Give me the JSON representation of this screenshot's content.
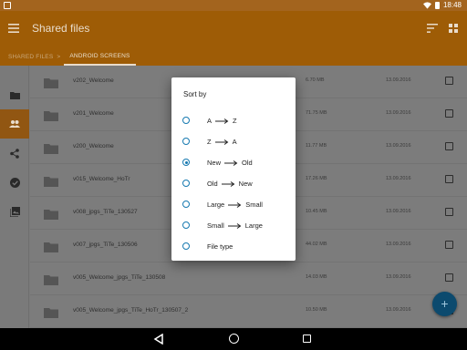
{
  "status_bar": {
    "time": "18:48"
  },
  "app_bar": {
    "title": "Shared files",
    "breadcrumbs": [
      "SHARED FILES",
      "ANDROID SCREENS"
    ],
    "breadcrumb_separator": ">"
  },
  "sidebar": {
    "items": [
      {
        "icon": "folder-icon",
        "active": false
      },
      {
        "icon": "people-icon",
        "active": true
      },
      {
        "icon": "share-icon",
        "active": false
      },
      {
        "icon": "checkmark-icon",
        "active": false
      },
      {
        "icon": "gallery-icon",
        "active": false
      }
    ]
  },
  "files": [
    {
      "name": "v202_Welcome",
      "size": "6.70 MB",
      "date": "13.09.2016"
    },
    {
      "name": "v201_Welcome",
      "size": "71.75 MB",
      "date": "13.09.2016"
    },
    {
      "name": "v200_Welcome",
      "size": "11.77 MB",
      "date": "13.09.2016"
    },
    {
      "name": "v015_Welcome_HoTr",
      "size": "17.26 MB",
      "date": "13.09.2016"
    },
    {
      "name": "v008_jpgs_TiTe_130527",
      "size": "10.45 MB",
      "date": "13.09.2016"
    },
    {
      "name": "v007_jpgs_TiTe_130506",
      "size": "44.02 MB",
      "date": "13.09.2016"
    },
    {
      "name": "v005_Welcome_jpgs_TiTe_130508",
      "size": "14.03 MB",
      "date": "13.09.2016"
    },
    {
      "name": "v005_Welcome_jpgs_TiTe_HoTr_130507_2",
      "size": "10.50 MB",
      "date": "13.09.2016"
    }
  ],
  "dialog": {
    "title": "Sort by",
    "options": [
      {
        "from": "A",
        "to": "Z",
        "selected": false
      },
      {
        "from": "Z",
        "to": "A",
        "selected": false
      },
      {
        "from": "New",
        "to": "Old",
        "selected": true
      },
      {
        "from": "Old",
        "to": "New",
        "selected": false
      },
      {
        "from": "Large",
        "to": "Small",
        "selected": false
      },
      {
        "from": "Small",
        "to": "Large",
        "selected": false
      },
      {
        "label": "File type",
        "selected": false
      }
    ]
  },
  "fab": {
    "label": "+"
  },
  "colors": {
    "accent": "#1679b0",
    "app_bar": "#9e5c06",
    "fab": "#0c4a6e"
  }
}
